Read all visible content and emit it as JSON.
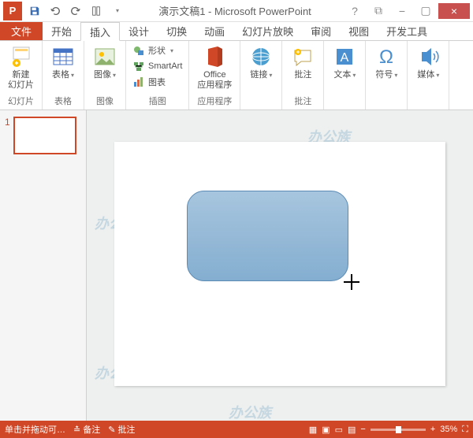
{
  "app": {
    "icon_letter": "P",
    "title": "演示文稿1 - Microsoft PowerPoint"
  },
  "win": {
    "help": "?",
    "restore": "⧉",
    "min": "−",
    "close": "×"
  },
  "tabs": {
    "file": "文件",
    "items": [
      "开始",
      "插入",
      "设计",
      "切换",
      "动画",
      "幻灯片放映",
      "审阅",
      "视图",
      "开发工具"
    ],
    "active_index": 1
  },
  "ribbon": {
    "new_slide": {
      "label": "新建\n幻灯片",
      "group": "幻灯片"
    },
    "table": {
      "label": "表格",
      "group": "表格"
    },
    "image": {
      "label": "图像",
      "group": "图像"
    },
    "shapes": "形状",
    "smartart": "SmartArt",
    "chart": "图表",
    "illus_group": "插图",
    "office": {
      "label": "Office\n应用程序",
      "group": "应用程序"
    },
    "link": {
      "label": "链接",
      "group": ""
    },
    "comment": {
      "label": "批注",
      "group": "批注"
    },
    "text": {
      "label": "文本"
    },
    "symbol": {
      "label": "符号"
    },
    "media": {
      "label": "媒体"
    }
  },
  "thumb": {
    "num": "1"
  },
  "watermark": "办公族",
  "status": {
    "left": "单击并拖动可…",
    "notes": "备注",
    "comments": "批注",
    "zoom": "35%"
  }
}
